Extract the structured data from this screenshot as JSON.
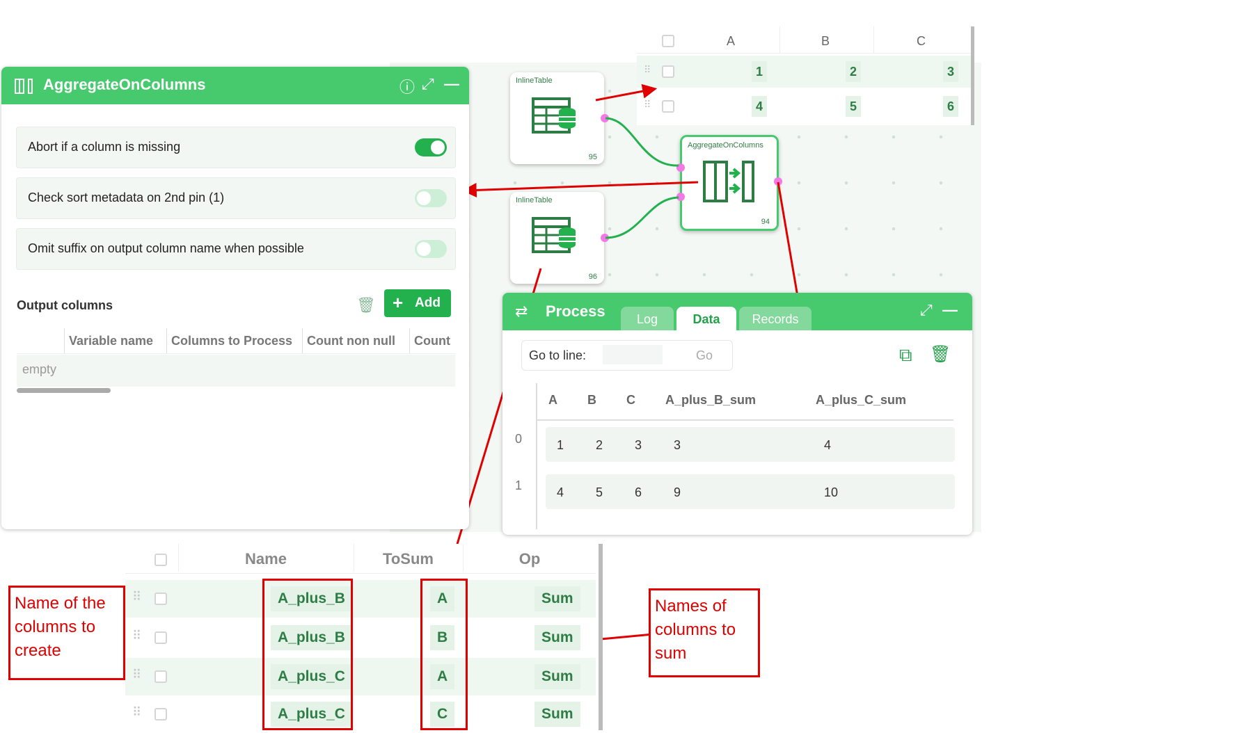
{
  "panel": {
    "title": "AggregateOnColumns",
    "options": [
      {
        "label": "Abort if a column is missing",
        "enabled": true
      },
      {
        "label": "Check sort metadata on 2nd pin (1)",
        "enabled": false
      },
      {
        "label": "Omit suffix on output column name when possible",
        "enabled": false
      }
    ],
    "output_title": "Output columns",
    "add_label": "Add",
    "columns": [
      "Variable name",
      "Columns to Process",
      "Count non null",
      "Count"
    ],
    "empty_label": "empty"
  },
  "nodes": [
    {
      "title": "InlineTable",
      "number": "95"
    },
    {
      "title": "InlineTable",
      "number": "96"
    },
    {
      "title": "AggregateOnColumns",
      "number": "94"
    }
  ],
  "input_table": {
    "headers": [
      "A",
      "B",
      "C"
    ],
    "rows": [
      [
        "1",
        "2",
        "3"
      ],
      [
        "4",
        "5",
        "6"
      ]
    ]
  },
  "process": {
    "title": "Process",
    "tabs": [
      "Log",
      "Data",
      "Records"
    ],
    "active_tab": "Data",
    "goto_label": "Go to line:",
    "go_label": "Go",
    "headers": [
      "A",
      "B",
      "C",
      "A_plus_B_sum",
      "A_plus_C_sum"
    ],
    "rows": [
      {
        "index": "0",
        "values": [
          "1",
          "2",
          "3",
          "3",
          "4"
        ]
      },
      {
        "index": "1",
        "values": [
          "4",
          "5",
          "6",
          "9",
          "10"
        ]
      }
    ]
  },
  "config_table": {
    "headers": [
      "Name",
      "ToSum",
      "Op"
    ],
    "rows": [
      {
        "name": "A_plus_B",
        "tosum": "A",
        "op": "Sum"
      },
      {
        "name": "A_plus_B",
        "tosum": "B",
        "op": "Sum"
      },
      {
        "name": "A_plus_C",
        "tosum": "A",
        "op": "Sum"
      },
      {
        "name": "A_plus_C",
        "tosum": "C",
        "op": "Sum"
      }
    ]
  },
  "callouts": {
    "left": "Name of the columns to create",
    "right": "Names of columns to sum"
  },
  "colors": {
    "accent": "#47c96e",
    "annotation": "#e00000",
    "pin": "#f279e6"
  }
}
